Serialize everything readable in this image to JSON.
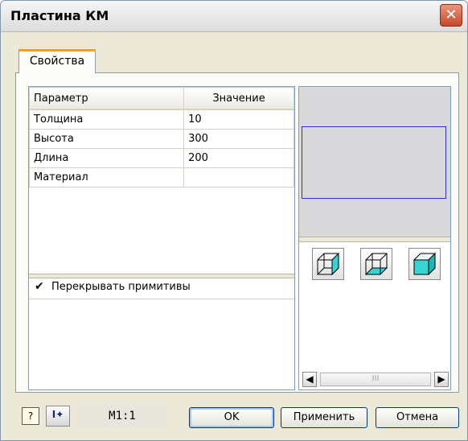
{
  "window": {
    "title": "Пластина КМ",
    "close_icon": "close-icon"
  },
  "tabs": [
    {
      "label": "Свойства",
      "active": true
    }
  ],
  "table": {
    "headers": [
      "Параметр",
      "Значение"
    ],
    "rows": [
      {
        "param": "Толщина",
        "value": "10"
      },
      {
        "param": "Высота",
        "value": "300"
      },
      {
        "param": "Длина",
        "value": "200"
      },
      {
        "param": "Материал",
        "value": ""
      }
    ]
  },
  "options": {
    "overlap_label": "Перекрывать примитивы",
    "overlap_checked": true
  },
  "preview": {
    "outline_color": "#2b2bd6",
    "face_color": "#39d3d3"
  },
  "view_buttons": [
    "wireframe-cube-icon",
    "bottom-face-cube-icon",
    "solid-cube-icon"
  ],
  "scrollbar": {
    "left_arrow": "◀",
    "right_arrow": "▶",
    "grip": "III"
  },
  "footer": {
    "help_icon": "?",
    "cursor_icon": "I✦",
    "scale": "M1:1",
    "ok_label": "OK",
    "apply_label": "Применить",
    "cancel_label": "Отмена"
  }
}
